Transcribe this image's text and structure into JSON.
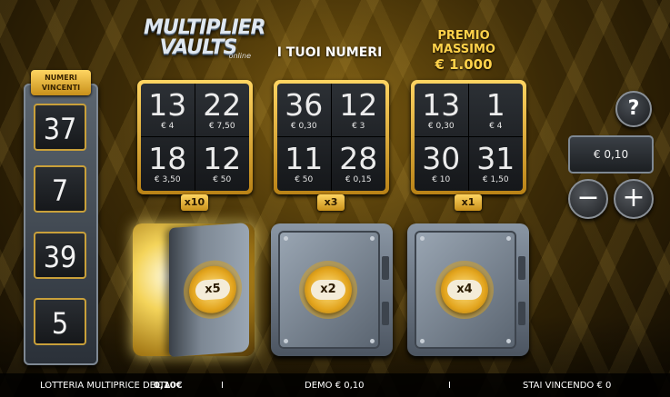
{
  "logo": {
    "line1": "MULTIPLIER",
    "line2": "VAULTS",
    "line3": "online"
  },
  "your_numbers_title": "I TUOI NUMERI",
  "prize": {
    "label": "PREMIO MASSIMO",
    "value": "€ 1.000"
  },
  "winning": {
    "label_line1": "NUMERI",
    "label_line2": "VINCENTI",
    "numbers": [
      "37",
      "7",
      "39",
      "5"
    ]
  },
  "cards": [
    {
      "multiplier": "x10",
      "cells": [
        {
          "n": "13",
          "p": "€ 4"
        },
        {
          "n": "22",
          "p": "€ 7,50"
        },
        {
          "n": "18",
          "p": "€ 3,50"
        },
        {
          "n": "12",
          "p": "€ 50"
        }
      ]
    },
    {
      "multiplier": "x3",
      "cells": [
        {
          "n": "36",
          "p": "€ 0,30"
        },
        {
          "n": "12",
          "p": "€ 3"
        },
        {
          "n": "11",
          "p": "€ 50"
        },
        {
          "n": "28",
          "p": "€ 0,15"
        }
      ]
    },
    {
      "multiplier": "x1",
      "cells": [
        {
          "n": "13",
          "p": "€ 0,30"
        },
        {
          "n": "1",
          "p": "€ 4"
        },
        {
          "n": "30",
          "p": "€ 10"
        },
        {
          "n": "31",
          "p": "€ 1,50"
        }
      ]
    }
  ],
  "controls": {
    "help": "?",
    "bet": "€ 0,10",
    "minus": "−",
    "plus": "+"
  },
  "vaults": [
    {
      "label": "x5",
      "state": "open"
    },
    {
      "label": "x2",
      "state": "closed"
    },
    {
      "label": "x4",
      "state": "closed"
    }
  ],
  "icons": {
    "help": "question-icon",
    "minus": "minus-icon",
    "plus": "plus-icon"
  },
  "bottom": {
    "game_name": "LOTTERIA MULTIPRICE DELTA",
    "game_price": "0,10€",
    "sep1": "I",
    "demo": "DEMO € 0,10",
    "sep2": "I",
    "winning": "STAI VINCENDO  € 0"
  },
  "colors": {
    "gold": "#ffd24a",
    "dark": "#15171a",
    "steel": "#8a96a4"
  }
}
